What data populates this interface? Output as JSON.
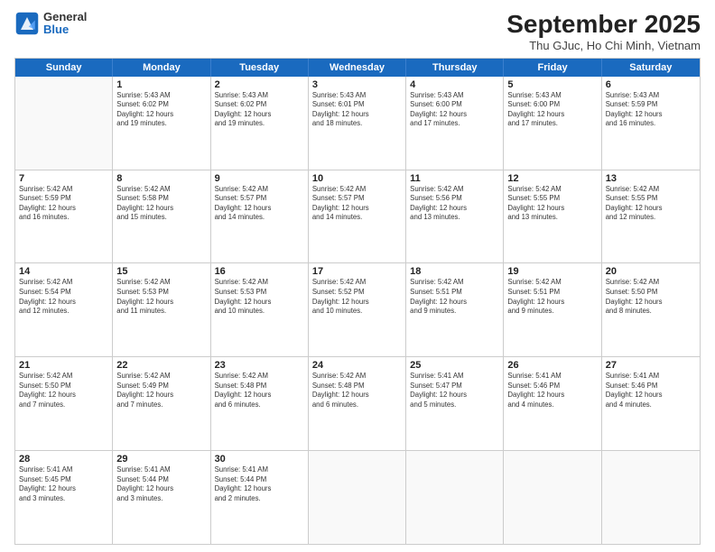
{
  "logo": {
    "general": "General",
    "blue": "Blue"
  },
  "title": "September 2025",
  "subtitle": "Thu GJuc, Ho Chi Minh, Vietnam",
  "headers": [
    "Sunday",
    "Monday",
    "Tuesday",
    "Wednesday",
    "Thursday",
    "Friday",
    "Saturday"
  ],
  "weeks": [
    [
      {
        "day": "",
        "info": ""
      },
      {
        "day": "1",
        "info": "Sunrise: 5:43 AM\nSunset: 6:02 PM\nDaylight: 12 hours\nand 19 minutes."
      },
      {
        "day": "2",
        "info": "Sunrise: 5:43 AM\nSunset: 6:02 PM\nDaylight: 12 hours\nand 19 minutes."
      },
      {
        "day": "3",
        "info": "Sunrise: 5:43 AM\nSunset: 6:01 PM\nDaylight: 12 hours\nand 18 minutes."
      },
      {
        "day": "4",
        "info": "Sunrise: 5:43 AM\nSunset: 6:00 PM\nDaylight: 12 hours\nand 17 minutes."
      },
      {
        "day": "5",
        "info": "Sunrise: 5:43 AM\nSunset: 6:00 PM\nDaylight: 12 hours\nand 17 minutes."
      },
      {
        "day": "6",
        "info": "Sunrise: 5:43 AM\nSunset: 5:59 PM\nDaylight: 12 hours\nand 16 minutes."
      }
    ],
    [
      {
        "day": "7",
        "info": "Sunrise: 5:42 AM\nSunset: 5:59 PM\nDaylight: 12 hours\nand 16 minutes."
      },
      {
        "day": "8",
        "info": "Sunrise: 5:42 AM\nSunset: 5:58 PM\nDaylight: 12 hours\nand 15 minutes."
      },
      {
        "day": "9",
        "info": "Sunrise: 5:42 AM\nSunset: 5:57 PM\nDaylight: 12 hours\nand 14 minutes."
      },
      {
        "day": "10",
        "info": "Sunrise: 5:42 AM\nSunset: 5:57 PM\nDaylight: 12 hours\nand 14 minutes."
      },
      {
        "day": "11",
        "info": "Sunrise: 5:42 AM\nSunset: 5:56 PM\nDaylight: 12 hours\nand 13 minutes."
      },
      {
        "day": "12",
        "info": "Sunrise: 5:42 AM\nSunset: 5:55 PM\nDaylight: 12 hours\nand 13 minutes."
      },
      {
        "day": "13",
        "info": "Sunrise: 5:42 AM\nSunset: 5:55 PM\nDaylight: 12 hours\nand 12 minutes."
      }
    ],
    [
      {
        "day": "14",
        "info": "Sunrise: 5:42 AM\nSunset: 5:54 PM\nDaylight: 12 hours\nand 12 minutes."
      },
      {
        "day": "15",
        "info": "Sunrise: 5:42 AM\nSunset: 5:53 PM\nDaylight: 12 hours\nand 11 minutes."
      },
      {
        "day": "16",
        "info": "Sunrise: 5:42 AM\nSunset: 5:53 PM\nDaylight: 12 hours\nand 10 minutes."
      },
      {
        "day": "17",
        "info": "Sunrise: 5:42 AM\nSunset: 5:52 PM\nDaylight: 12 hours\nand 10 minutes."
      },
      {
        "day": "18",
        "info": "Sunrise: 5:42 AM\nSunset: 5:51 PM\nDaylight: 12 hours\nand 9 minutes."
      },
      {
        "day": "19",
        "info": "Sunrise: 5:42 AM\nSunset: 5:51 PM\nDaylight: 12 hours\nand 9 minutes."
      },
      {
        "day": "20",
        "info": "Sunrise: 5:42 AM\nSunset: 5:50 PM\nDaylight: 12 hours\nand 8 minutes."
      }
    ],
    [
      {
        "day": "21",
        "info": "Sunrise: 5:42 AM\nSunset: 5:50 PM\nDaylight: 12 hours\nand 7 minutes."
      },
      {
        "day": "22",
        "info": "Sunrise: 5:42 AM\nSunset: 5:49 PM\nDaylight: 12 hours\nand 7 minutes."
      },
      {
        "day": "23",
        "info": "Sunrise: 5:42 AM\nSunset: 5:48 PM\nDaylight: 12 hours\nand 6 minutes."
      },
      {
        "day": "24",
        "info": "Sunrise: 5:42 AM\nSunset: 5:48 PM\nDaylight: 12 hours\nand 6 minutes."
      },
      {
        "day": "25",
        "info": "Sunrise: 5:41 AM\nSunset: 5:47 PM\nDaylight: 12 hours\nand 5 minutes."
      },
      {
        "day": "26",
        "info": "Sunrise: 5:41 AM\nSunset: 5:46 PM\nDaylight: 12 hours\nand 4 minutes."
      },
      {
        "day": "27",
        "info": "Sunrise: 5:41 AM\nSunset: 5:46 PM\nDaylight: 12 hours\nand 4 minutes."
      }
    ],
    [
      {
        "day": "28",
        "info": "Sunrise: 5:41 AM\nSunset: 5:45 PM\nDaylight: 12 hours\nand 3 minutes."
      },
      {
        "day": "29",
        "info": "Sunrise: 5:41 AM\nSunset: 5:44 PM\nDaylight: 12 hours\nand 3 minutes."
      },
      {
        "day": "30",
        "info": "Sunrise: 5:41 AM\nSunset: 5:44 PM\nDaylight: 12 hours\nand 2 minutes."
      },
      {
        "day": "",
        "info": ""
      },
      {
        "day": "",
        "info": ""
      },
      {
        "day": "",
        "info": ""
      },
      {
        "day": "",
        "info": ""
      }
    ]
  ]
}
